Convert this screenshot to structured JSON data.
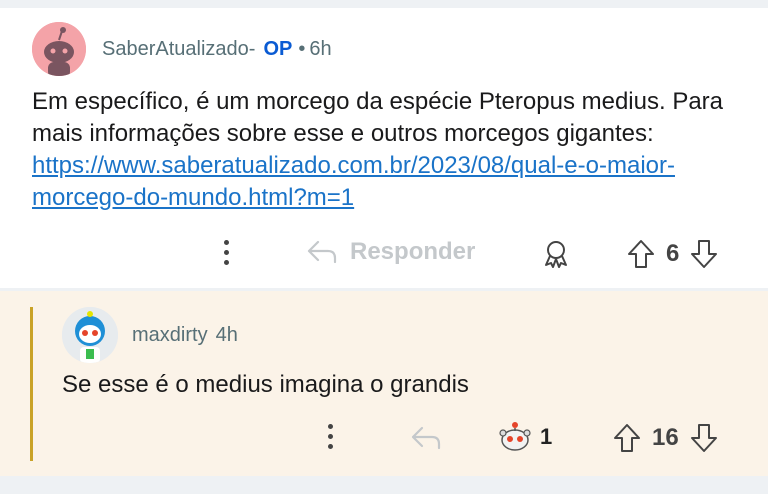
{
  "comment_1": {
    "author": "SaberAtualizado-",
    "op_badge": "OP",
    "separator": "•",
    "time": "6h",
    "body_text": "Em específico, é um morcego da espécie Pteropus medius. Para mais informações sobre esse e outros morcegos gigantes: ",
    "link_text": "https://www.saberatualizado.com.br/2023/08/qual-e-o-maior-morcego-do-mundo.html?m=1",
    "reply_label": "Responder",
    "score": "6",
    "icons": [
      "more-vertical-icon",
      "reply-arrow-icon",
      "award-icon",
      "upvote-icon",
      "downvote-icon"
    ],
    "avatar_color": "#f4a3a8"
  },
  "comment_2": {
    "author": "maxdirty",
    "time": "4h",
    "body_text": "Se esse é o medius imagina o grandis",
    "award_count": "1",
    "score": "16",
    "icons": [
      "more-vertical-icon",
      "reply-arrow-icon",
      "snoo-award-icon",
      "upvote-icon",
      "downvote-icon"
    ],
    "thread_line_color": "#c9a227",
    "background_color": "#fbf3e8"
  },
  "colors": {
    "op_badge": "#0a5bd3",
    "link": "#1a73c8",
    "meta_text": "#576f76"
  }
}
